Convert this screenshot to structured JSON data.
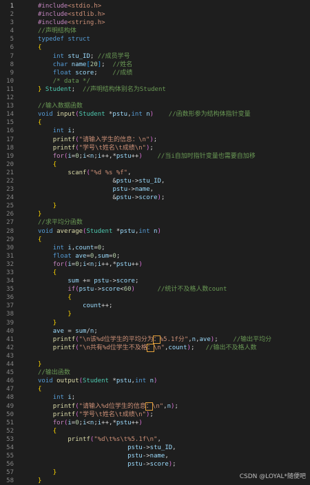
{
  "editor": {
    "lines": [
      "#include<stdio.h>",
      "#include<stdlib.h>",
      "#include<string.h>",
      "//声明结构体",
      "typedef struct",
      "{",
      "    int stu_ID; //成员学号",
      "    char name[20];  //姓名",
      "    float score;    //成绩",
      "    /* data */",
      "} Student;  //声明结构体别名为Student",
      "",
      "//输入数据函数",
      "void input(Student *pstu,int n)    //函数形参为结构体指针变量",
      "{",
      "    int i;",
      "    printf(\"请输入学生的信息：\\n\");",
      "    printf(\"学号\\t姓名\\t成绩\\n\");",
      "    for(i=0;i<n;i++,*pstu++)    //当i自加时指针变量也需要自加移",
      "    {",
      "        scanf(\"%d %s %f\",",
      "                    &pstu->stu_ID,",
      "                    pstu->name,",
      "                    &pstu->score);",
      "    }",
      "}",
      "//求平均分函数",
      "void average(Student *pstu,int n)",
      "{",
      "    int i,count=0;",
      "    float ave=0,sum=0;",
      "    for(i=0;i<n;i++,*pstu++)",
      "    {",
      "        sum += pstu->score;",
      "        if(pstu->score<60)      //统计不及格人数count",
      "        {",
      "            count++;",
      "        }",
      "    }",
      "    ave = sum/n;",
      "    printf(\"\\n该%d位学生的平均分为：%5.1f分\",n,ave);    //输出平均分",
      "    printf(\"\\n共有%d位学生不及格：\\n\",count);   //输出不及格人数",
      "",
      "}",
      "//输出函数",
      "void output(Student *pstu,int n)",
      "{",
      "    int i;",
      "    printf(\"请输入%d位学生的信息：\\n\",n);",
      "    printf(\"学号\\t姓名\\t成绩\\n\");",
      "    for(i=0;i<n;i++,*pstu++)",
      "    {",
      "        printf(\"%d\\t%s\\t%5.1f\\n\",",
      "                        pstu->stu_ID,",
      "                        pstu->name,",
      "                        pstu->score);",
      "    }",
      "}"
    ],
    "active_line": 1
  },
  "watermark": "CSDN @LOYAL*随便吧"
}
